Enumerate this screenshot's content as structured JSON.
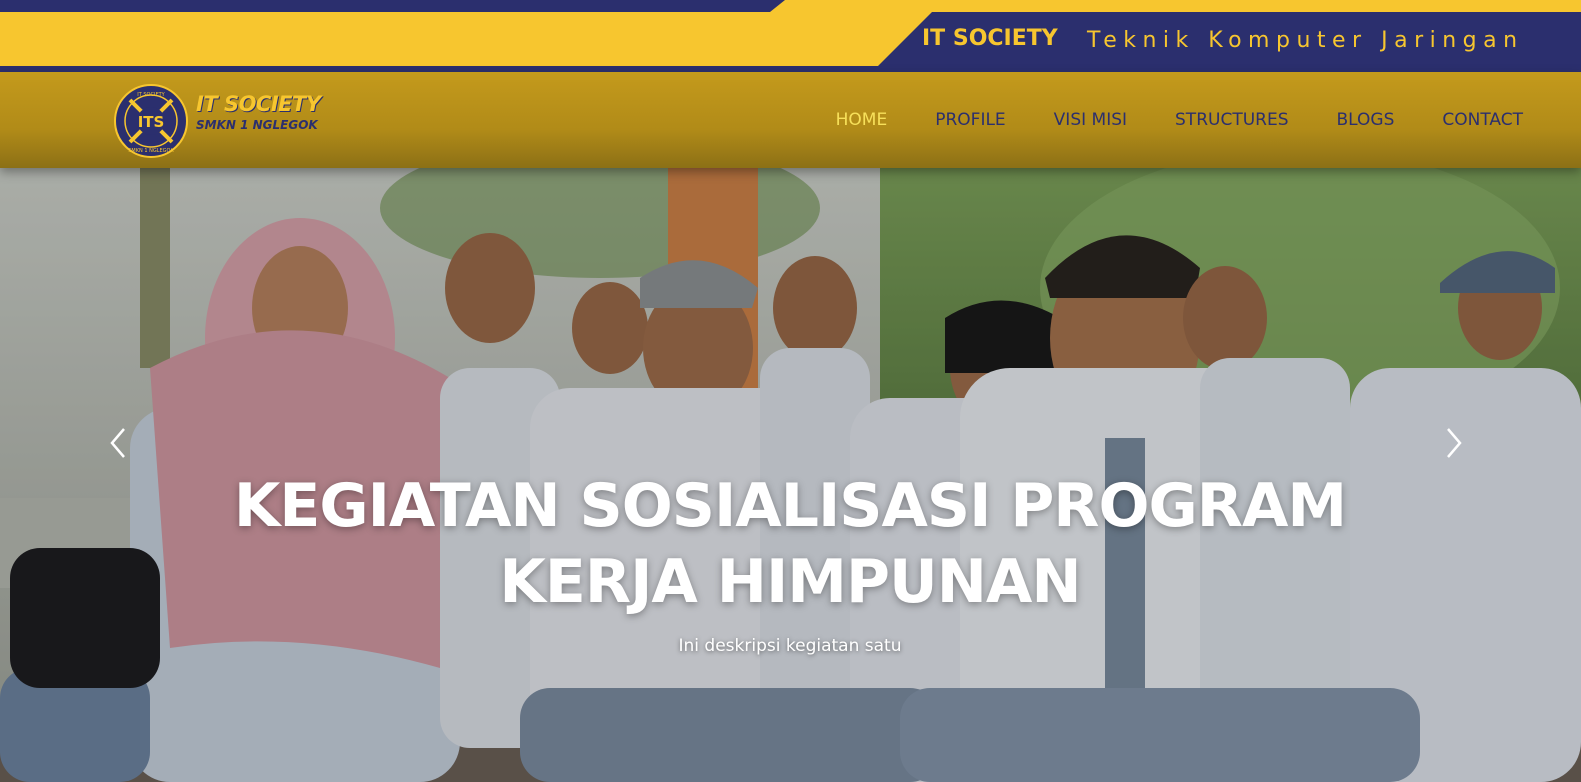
{
  "topbar": {
    "brand": "IT SOCIETY",
    "tagline": "Teknik Komputer Jaringan",
    "colors": {
      "navy": "#2b2f6e",
      "yellow": "#f7c62f"
    }
  },
  "logo": {
    "title": "IT SOCIETY",
    "subtitle": "SMKN 1 NGLEGOK",
    "badge_initials": "ITS",
    "badge_ring_top": "IT SOCIETY",
    "badge_ring_bottom": "SMKN 1 NGLEGOK"
  },
  "nav": {
    "items": [
      {
        "label": "HOME",
        "active": true
      },
      {
        "label": "PROFILE",
        "active": false
      },
      {
        "label": "VISI MISI",
        "active": false
      },
      {
        "label": "STRUCTURES",
        "active": false
      },
      {
        "label": "BLOGS",
        "active": false
      },
      {
        "label": "CONTACT",
        "active": false
      }
    ]
  },
  "hero": {
    "title": "KEGIATAN SOSIALISASI PROGRAM KERJA HIMPUNAN",
    "description": "Ini deskripsi kegiatan satu",
    "prev_icon": "chevron-left-icon",
    "next_icon": "chevron-right-icon"
  }
}
